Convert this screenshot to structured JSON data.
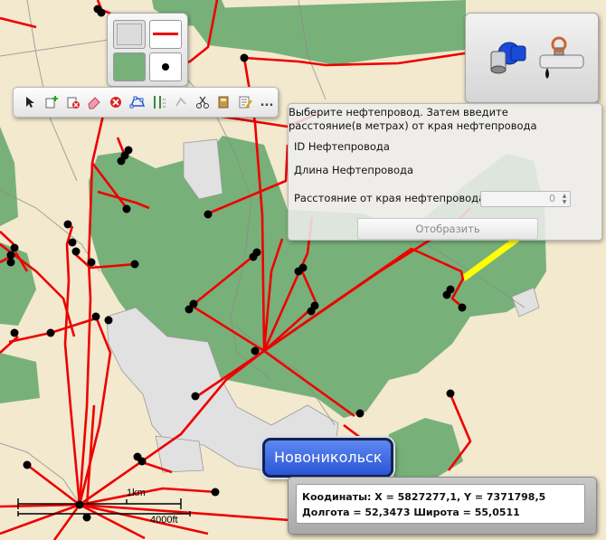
{
  "map": {
    "city_name": "Новоникольск",
    "scale_bar": {
      "label_km": "1km",
      "label_ft": "4000ft"
    },
    "colors": {
      "terrain": "#f2e9cf",
      "forest": "#78b07a",
      "urban": "#e1e1e1",
      "pipeline": "#ee0000",
      "selected_pipeline": "#ffff00",
      "node": "#000000"
    }
  },
  "symbol_panel": {
    "icons": [
      "polygon-swatch-icon",
      "line-swatch-icon",
      "area-fill-swatch-icon",
      "point-swatch-icon"
    ]
  },
  "toolbar": {
    "tools": [
      "select-arrow-icon",
      "add-feature-icon",
      "delete-feature-icon",
      "eraser-icon",
      "delete-icon",
      "edit-vertices-icon",
      "split-icon",
      "reshape-icon",
      "cut-icon",
      "attributes-icon",
      "edit-properties-icon"
    ],
    "more_label": "..."
  },
  "layer_panel": {
    "icons": [
      "valve-icon",
      "pipe-leak-icon"
    ]
  },
  "measure_dialog": {
    "instruction": "Выберите нефтепровод. Затем введите расстояние(в метрах) от края нефтепровода",
    "pipeline_id_label": "ID Нефтепровода",
    "pipeline_length_label": "Длина Нефтепровода",
    "distance_label": "Расстояние от края нефтепровода",
    "distance_value": "0",
    "show_button": "Отобразить"
  },
  "coordinates": {
    "line1": "Коодинаты: X = 5827277,1, Y = 7371798,5",
    "line2": "Долгота = 52,3473 Широта = 55,0511"
  }
}
